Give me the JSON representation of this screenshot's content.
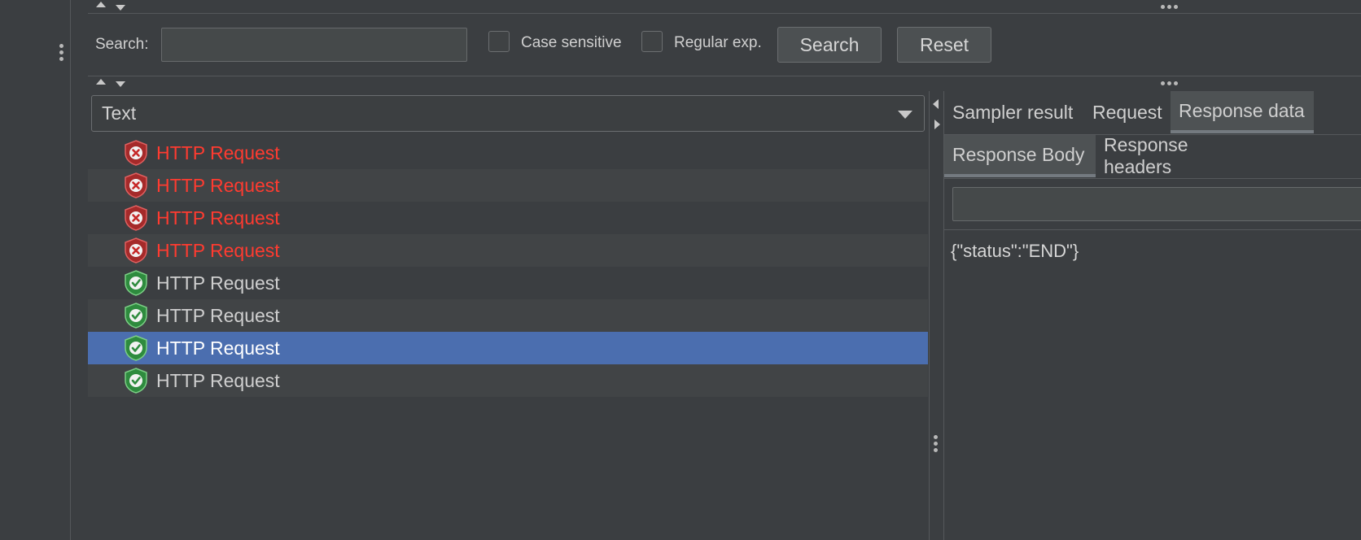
{
  "search": {
    "label": "Search:",
    "value": "",
    "case_sensitive_label": "Case sensitive",
    "case_sensitive_checked": false,
    "regex_label": "Regular exp.",
    "regex_checked": false,
    "search_button": "Search",
    "reset_button": "Reset"
  },
  "renderer": {
    "selected": "Text"
  },
  "results": [
    {
      "label": "HTTP Request",
      "status": "error",
      "icon": "error-shield-icon"
    },
    {
      "label": "HTTP Request",
      "status": "error",
      "icon": "error-shield-icon"
    },
    {
      "label": "HTTP Request",
      "status": "error",
      "icon": "error-shield-icon"
    },
    {
      "label": "HTTP Request",
      "status": "error",
      "icon": "error-shield-icon"
    },
    {
      "label": "HTTP Request",
      "status": "success",
      "icon": "success-shield-icon"
    },
    {
      "label": "HTTP Request",
      "status": "success",
      "icon": "success-shield-icon"
    },
    {
      "label": "HTTP Request",
      "status": "success",
      "icon": "success-shield-icon",
      "selected": true
    },
    {
      "label": "HTTP Request",
      "status": "success",
      "icon": "success-shield-icon"
    }
  ],
  "detail": {
    "tabs": [
      "Sampler result",
      "Request",
      "Response data"
    ],
    "active_tab": "Response data",
    "subtabs": [
      "Response Body",
      "Response headers"
    ],
    "active_subtab": "Response Body",
    "find_value": "",
    "body": "{\"status\":\"END\"}"
  },
  "colors": {
    "background": "#3b3e41",
    "error_text": "#ff3b30",
    "selection": "#4b6eaf",
    "error_icon": "#d93a3a",
    "success_icon": "#3fa34d"
  }
}
